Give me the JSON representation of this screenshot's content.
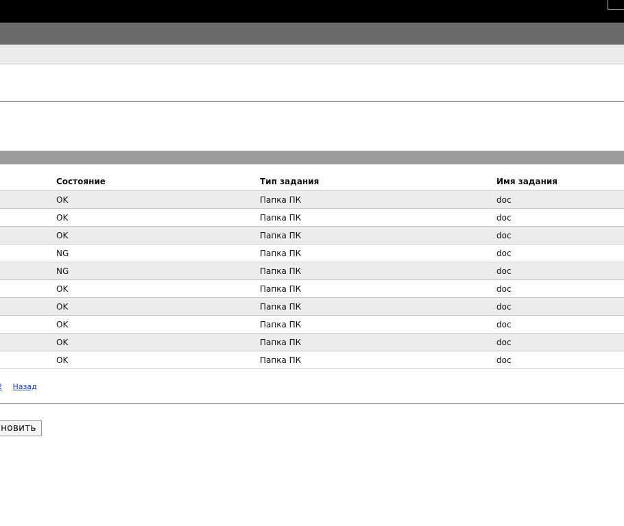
{
  "table": {
    "headers": [
      "",
      "Состояние",
      "Тип задания",
      "Имя задания"
    ],
    "rows": [
      {
        "status": "OK",
        "type": "Папка ПК",
        "name": "doc"
      },
      {
        "status": "OK",
        "type": "Папка ПК",
        "name": "doc"
      },
      {
        "status": "OK",
        "type": "Папка ПК",
        "name": "doc"
      },
      {
        "status": "NG",
        "type": "Папка ПК",
        "name": "doc"
      },
      {
        "status": "NG",
        "type": "Папка ПК",
        "name": "doc"
      },
      {
        "status": "OK",
        "type": "Папка ПК",
        "name": "doc"
      },
      {
        "status": "OK",
        "type": "Папка ПК",
        "name": "doc"
      },
      {
        "status": "OK",
        "type": "Папка ПК",
        "name": "doc"
      },
      {
        "status": "OK",
        "type": "Папка ПК",
        "name": "doc"
      },
      {
        "status": "OK",
        "type": "Папка ПК",
        "name": "doc"
      }
    ]
  },
  "pager": {
    "page_label": "2",
    "back_label": "Назад"
  },
  "actions": {
    "refresh_label": "новить"
  }
}
